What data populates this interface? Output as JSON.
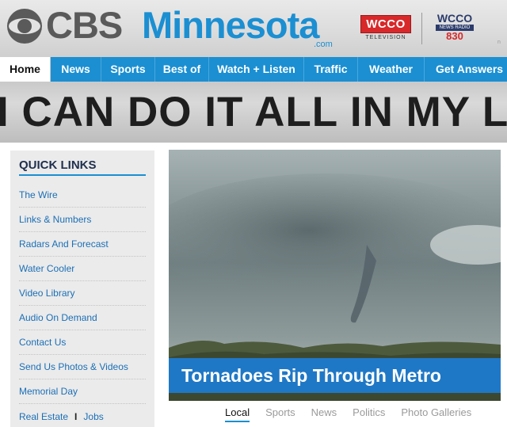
{
  "header": {
    "brand_cbs": "CBS",
    "brand_city": "Minnesota",
    "brand_domain": ".com",
    "wcco_tv": {
      "name": "WCCO",
      "sub": "TELEVISION"
    },
    "wcco_radio": {
      "name": "WCCO",
      "sub": "NEWS RADIO",
      "freq": "830"
    },
    "fragment_a": "",
    "fragment_b": "n"
  },
  "nav": {
    "items": [
      {
        "label": "Home",
        "active": true
      },
      {
        "label": "News"
      },
      {
        "label": "Sports"
      },
      {
        "label": "Best of"
      },
      {
        "label": "Watch + Listen"
      },
      {
        "label": "Traffic"
      },
      {
        "label": "Weather"
      },
      {
        "label": "Get Answers"
      }
    ]
  },
  "banner": {
    "text": "I CAN DO IT ALL IN MY LIF"
  },
  "quick_links": {
    "title": "QUICK LINKS",
    "items": [
      "The Wire",
      "Links & Numbers",
      "Radars And Forecast",
      "Water Cooler",
      "Video Library",
      "Audio On Demand",
      "Contact Us",
      "Send Us Photos & Videos",
      "Memorial Day"
    ],
    "last_row": {
      "left": "Real Estate",
      "separator": "I",
      "right": "Jobs"
    }
  },
  "hero": {
    "caption": "Tornadoes Rip Through Metro",
    "image_subject": "funnel-cloud-photo"
  },
  "tabs": [
    {
      "label": "Local",
      "active": true
    },
    {
      "label": "Sports"
    },
    {
      "label": "News"
    },
    {
      "label": "Politics"
    },
    {
      "label": "Photo Galleries"
    }
  ],
  "colors": {
    "brand_blue": "#1b8fd2",
    "caption_blue": "#1f78c6",
    "wcco_red": "#d8282a",
    "link_blue": "#1b6fb6"
  }
}
